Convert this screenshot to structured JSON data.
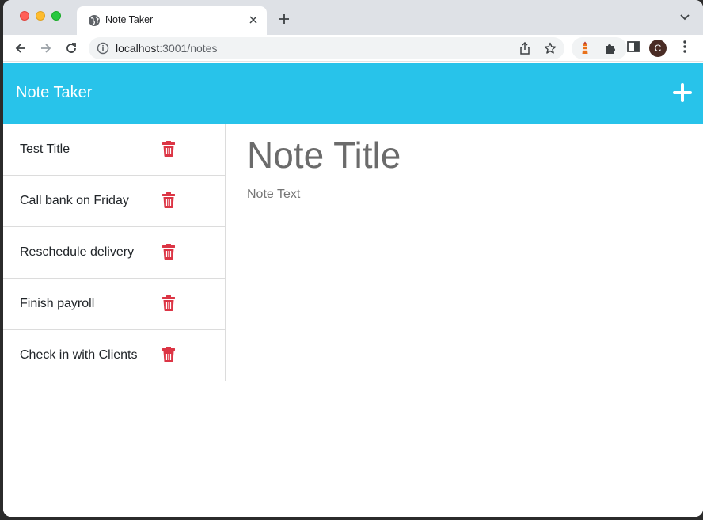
{
  "browser": {
    "tab": {
      "title": "Note Taker",
      "favicon": "globe-icon"
    },
    "url": {
      "host": "localhost",
      "rest": ":3001/notes"
    },
    "profile_initial": "C"
  },
  "app": {
    "brand": "Note Taker",
    "accent_color": "#28c3ea",
    "delete_color": "#dc3545",
    "notes": [
      {
        "title": "Test Title"
      },
      {
        "title": "Call bank on Friday"
      },
      {
        "title": "Reschedule delivery"
      },
      {
        "title": "Finish payroll"
      },
      {
        "title": "Check in with Clients"
      }
    ],
    "editor": {
      "title_placeholder": "Note Title",
      "text_placeholder": "Note Text"
    }
  }
}
